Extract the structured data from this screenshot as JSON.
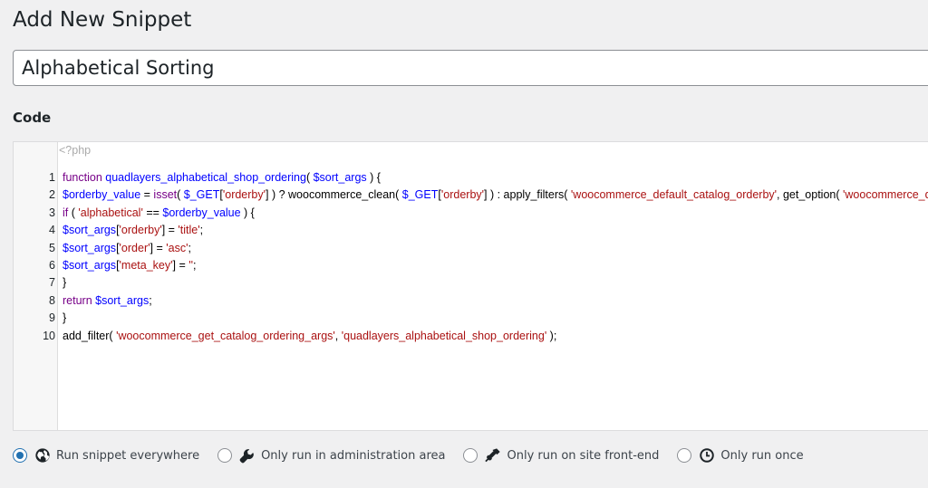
{
  "header": {
    "title": "Add New Snippet"
  },
  "snippet_title": {
    "value": "Alphabetical Sorting"
  },
  "code_section": {
    "heading": "Code"
  },
  "editor": {
    "php_open_tag": "<?php",
    "lines": [
      {
        "number": "1",
        "tokens": [
          {
            "t": "kw",
            "v": "function "
          },
          {
            "t": "def",
            "v": "quadlayers_alphabetical_shop_ordering"
          },
          {
            "t": "pl",
            "v": "( "
          },
          {
            "t": "var",
            "v": "$sort_args"
          },
          {
            "t": "pl",
            "v": " ) {"
          }
        ]
      },
      {
        "number": "2",
        "tokens": [
          {
            "t": "var",
            "v": "$orderby_value"
          },
          {
            "t": "pl",
            "v": " = "
          },
          {
            "t": "kw",
            "v": "isset"
          },
          {
            "t": "pl",
            "v": "( "
          },
          {
            "t": "var",
            "v": "$_GET"
          },
          {
            "t": "pl",
            "v": "["
          },
          {
            "t": "str",
            "v": "'orderby'"
          },
          {
            "t": "pl",
            "v": "] ) ? woocommerce_clean( "
          },
          {
            "t": "var",
            "v": "$_GET"
          },
          {
            "t": "pl",
            "v": "["
          },
          {
            "t": "str",
            "v": "'orderby'"
          },
          {
            "t": "pl",
            "v": "] ) : apply_filters( "
          },
          {
            "t": "str",
            "v": "'woocommerce_default_catalog_orderby'"
          },
          {
            "t": "pl",
            "v": ", get_option( "
          },
          {
            "t": "str",
            "v": "'woocommerce_default_catalog_orderby'"
          },
          {
            "t": "pl",
            "v": " ) );"
          }
        ]
      },
      {
        "number": "3",
        "tokens": [
          {
            "t": "kw",
            "v": "if"
          },
          {
            "t": "pl",
            "v": " ( "
          },
          {
            "t": "str",
            "v": "'alphabetical'"
          },
          {
            "t": "pl",
            "v": " == "
          },
          {
            "t": "var",
            "v": "$orderby_value"
          },
          {
            "t": "pl",
            "v": " ) {"
          }
        ]
      },
      {
        "number": "4",
        "tokens": [
          {
            "t": "var",
            "v": "$sort_args"
          },
          {
            "t": "pl",
            "v": "["
          },
          {
            "t": "str",
            "v": "'orderby'"
          },
          {
            "t": "pl",
            "v": "] = "
          },
          {
            "t": "str",
            "v": "'title'"
          },
          {
            "t": "pl",
            "v": ";"
          }
        ]
      },
      {
        "number": "5",
        "tokens": [
          {
            "t": "var",
            "v": "$sort_args"
          },
          {
            "t": "pl",
            "v": "["
          },
          {
            "t": "str",
            "v": "'order'"
          },
          {
            "t": "pl",
            "v": "] = "
          },
          {
            "t": "str",
            "v": "'asc'"
          },
          {
            "t": "pl",
            "v": ";"
          }
        ]
      },
      {
        "number": "6",
        "tokens": [
          {
            "t": "var",
            "v": "$sort_args"
          },
          {
            "t": "pl",
            "v": "["
          },
          {
            "t": "str",
            "v": "'meta_key'"
          },
          {
            "t": "pl",
            "v": "] = "
          },
          {
            "t": "str",
            "v": "''"
          },
          {
            "t": "pl",
            "v": ";"
          }
        ]
      },
      {
        "number": "7",
        "tokens": [
          {
            "t": "pl",
            "v": "}"
          }
        ]
      },
      {
        "number": "8",
        "tokens": [
          {
            "t": "kw",
            "v": "return "
          },
          {
            "t": "var",
            "v": "$sort_args"
          },
          {
            "t": "pl",
            "v": ";"
          }
        ]
      },
      {
        "number": "9",
        "tokens": [
          {
            "t": "pl",
            "v": "}"
          }
        ]
      },
      {
        "number": "10",
        "tokens": [
          {
            "t": "pl",
            "v": "add_filter( "
          },
          {
            "t": "str",
            "v": "'woocommerce_get_catalog_ordering_args'"
          },
          {
            "t": "pl",
            "v": ", "
          },
          {
            "t": "str",
            "v": "'quadlayers_alphabetical_shop_ordering'"
          },
          {
            "t": "pl",
            "v": " );"
          }
        ]
      }
    ]
  },
  "run_options": [
    {
      "label": "Run snippet everywhere",
      "icon": "globe-icon",
      "checked": true
    },
    {
      "label": "Only run in administration area",
      "icon": "wrench-icon",
      "checked": false
    },
    {
      "label": "Only run on site front-end",
      "icon": "admin-appearance-icon",
      "checked": false
    },
    {
      "label": "Only run once",
      "icon": "clock-icon",
      "checked": false
    }
  ],
  "colors": {
    "background": "#f0f0f1",
    "radio_accent": "#2271b1",
    "keyword": "#770088",
    "variable": "#0000ff",
    "string": "#aa1111"
  }
}
